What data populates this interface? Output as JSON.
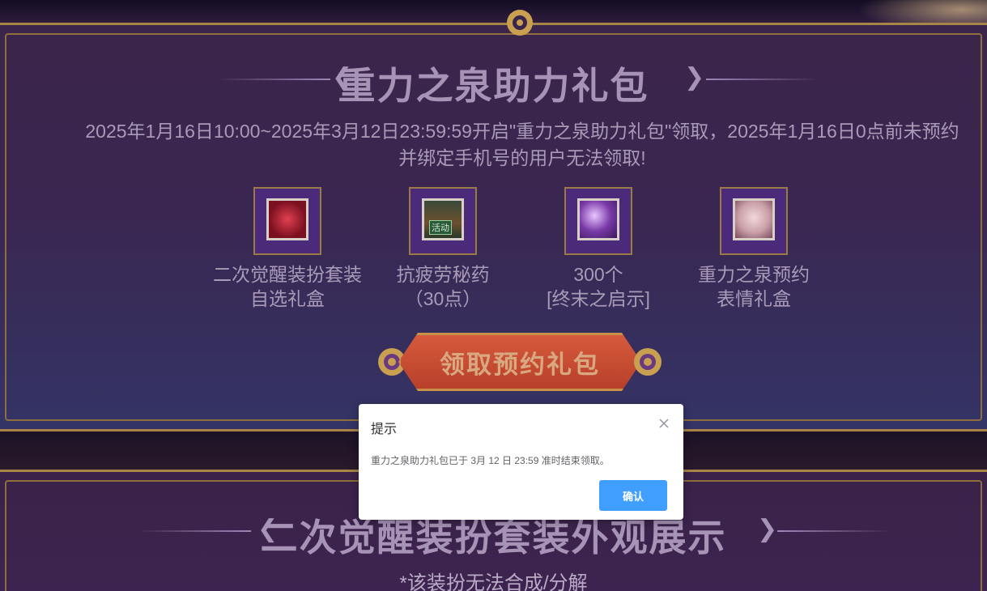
{
  "section1": {
    "title": "重力之泉助力礼包",
    "description_line1": "2025年1月16日10:00~2025年3月12日23:59:59开启\"重力之泉助力礼包\"领取，2025年1月16日0点前未预约",
    "description_line2": "并绑定手机号的用户无法领取!",
    "items": [
      {
        "line1": "二次觉醒装扮套装",
        "line2": "自选礼盒",
        "icon": "red-book-icon"
      },
      {
        "line1": "抗疲劳秘药",
        "line2": "（30点）",
        "icon": "potion-icon",
        "icon_tag": "活动"
      },
      {
        "line1": "300个",
        "line2": "[终末之启示]",
        "icon": "purple-orb-icon"
      },
      {
        "line1": "重力之泉预约",
        "line2": "表情礼盒",
        "icon": "face-emote-icon"
      }
    ],
    "claim_button": "领取预约礼包"
  },
  "section2": {
    "title": "二次觉醒装扮套装外观展示",
    "note": "*该装扮无法合成/分解"
  },
  "dialog": {
    "title": "提示",
    "message": "重力之泉助力礼包已于 3月 12 日 23:59 准时结束领取。",
    "confirm": "确认"
  },
  "colors": {
    "panel": "#3a2650",
    "border_gold": "#a78448",
    "confirm_blue": "#409eff"
  }
}
